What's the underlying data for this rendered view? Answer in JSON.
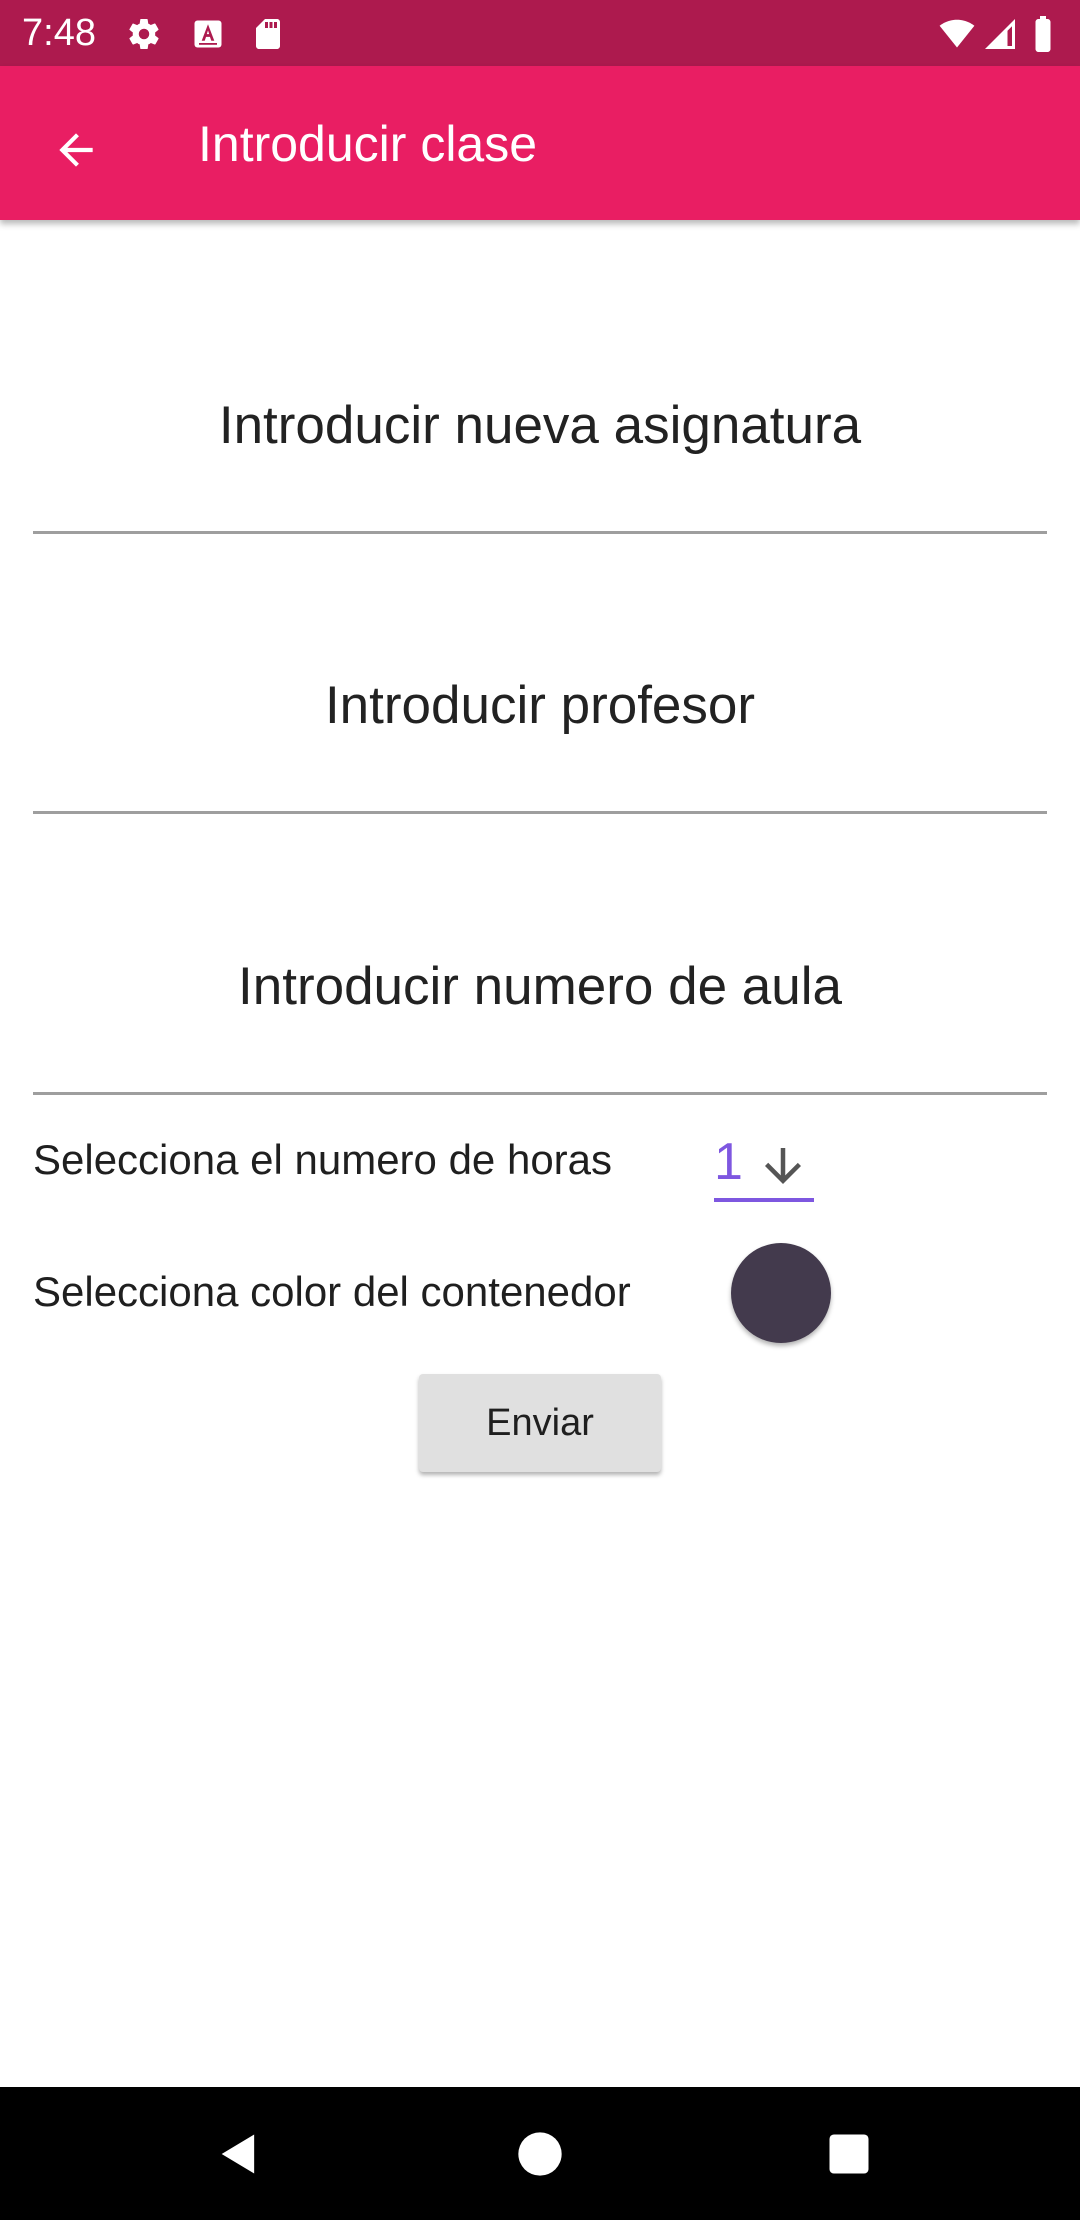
{
  "status_bar": {
    "time": "7:48",
    "left_icons": [
      "gear-icon",
      "font-a-icon",
      "sd-card-icon"
    ],
    "right_icons": [
      "wifi-icon",
      "signal-icon",
      "battery-icon"
    ]
  },
  "app_bar": {
    "title": "Introducir clase",
    "back_icon": "arrow-back-icon"
  },
  "form": {
    "subject_hint": "Introducir nueva asignatura",
    "teacher_hint": "Introducir profesor",
    "room_hint": "Introducir numero de aula",
    "hours_label": "Selecciona el numero de horas",
    "hours_value": "1",
    "color_label": "Selecciona color del contenedor",
    "container_color": "#433A4D",
    "submit_label": "Enviar"
  },
  "nav_bar": {
    "buttons": [
      "back-triangle-icon",
      "home-circle-icon",
      "recents-square-icon"
    ]
  },
  "colors": {
    "status_bar": "#AD1A4E",
    "app_bar": "#E91E63",
    "accent": "#7E57E0",
    "divider": "#9E9E9E"
  }
}
